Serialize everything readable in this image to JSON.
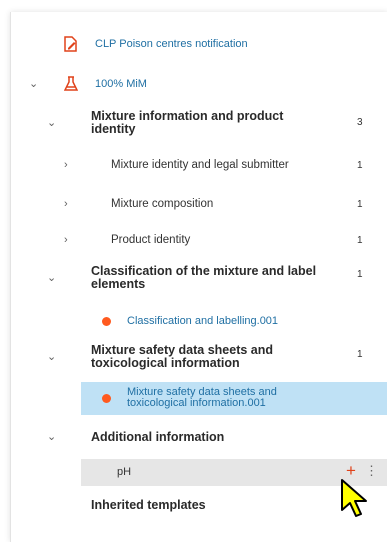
{
  "header": {
    "title": "CLP Poison centres notification",
    "icon": "notification-edit-icon"
  },
  "dossier": {
    "label": "100% MiM",
    "icon": "flask-icon"
  },
  "tree": {
    "mixture_info": {
      "label": "Mixture information and product identity",
      "count": "3",
      "children": [
        {
          "label": "Mixture identity and legal submitter",
          "count": "1"
        },
        {
          "label": "Mixture composition",
          "count": "1"
        },
        {
          "label": "Product identity",
          "count": "1"
        }
      ]
    },
    "classification": {
      "label": "Classification of the mixture and label elements",
      "count": "1",
      "doc": "Classification and labelling.001"
    },
    "sds": {
      "label": "Mixture safety data sheets and toxicological information",
      "count": "1",
      "doc": "Mixture safety data sheets and toxicological information.001"
    },
    "additional": {
      "label": "Additional information",
      "item": "pH",
      "add_symbol": "+",
      "more_symbol": "⋮"
    },
    "inherited": {
      "label": "Inherited templates"
    }
  },
  "colors": {
    "link": "#1f6fa3",
    "accent": "#ff5a1f",
    "selected": "#bfe1f5",
    "hover": "#e6e6e6"
  }
}
